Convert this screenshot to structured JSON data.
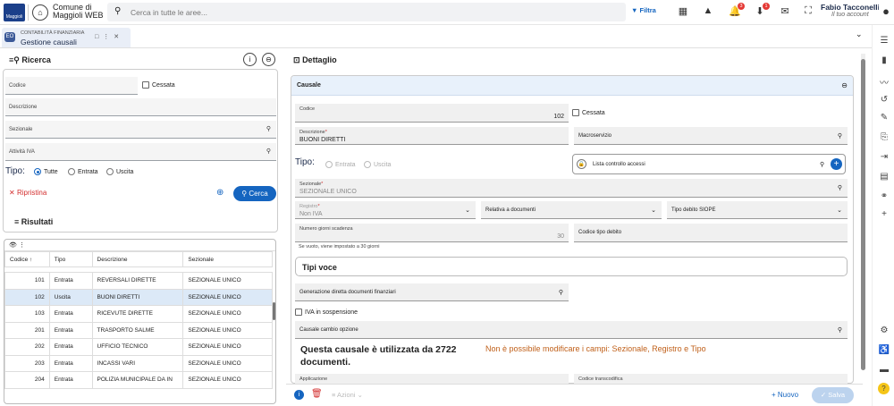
{
  "app": {
    "logo_text": "Maggioli",
    "name_line1": "Comune di",
    "name_line2": "Maggioli WEB"
  },
  "search": {
    "placeholder": "Cerca in tutte le aree..."
  },
  "topbar": {
    "filter_label": "Filtra",
    "badges": {
      "notifications": "3",
      "downloads": "1"
    }
  },
  "user": {
    "name": "Fabio Tacconelli",
    "role": "Il tuo account"
  },
  "tab": {
    "badge": "EO",
    "subtitle": "CONTABILITÀ FINANZIARIA",
    "title": "Gestione causali"
  },
  "ricerca": {
    "title": "Ricerca",
    "fields": {
      "codice": "Codice",
      "descrizione": "Descrizione",
      "sezionale": "Sezionale",
      "attivita_iva": "Attività IVA"
    },
    "cessata_label": "Cessata",
    "tipo_label": "Tipo:",
    "tipo_options": [
      "Tutte",
      "Entrata",
      "Uscita"
    ],
    "ripristina": "Ripristina",
    "cerca": "Cerca"
  },
  "risultati": {
    "title": "Risultati",
    "columns": [
      "Codice ↑",
      "Tipo",
      "Descrizione",
      "Sezionale"
    ],
    "rows": [
      [
        "101",
        "Entrata",
        "REVERSALI DIRETTE",
        "SEZIONALE UNICO"
      ],
      [
        "102",
        "Uscita",
        "BUONI DIRETTI",
        "SEZIONALE UNICO"
      ],
      [
        "103",
        "Entrata",
        "RICEVUTE DIRETTE",
        "SEZIONALE UNICO"
      ],
      [
        "201",
        "Entrata",
        "TRASPORTO SALME",
        "SEZIONALE UNICO"
      ],
      [
        "202",
        "Entrata",
        "UFFICIO TECNICO",
        "SEZIONALE UNICO"
      ],
      [
        "203",
        "Entrata",
        "INCASSI VARI",
        "SEZIONALE UNICO"
      ],
      [
        "204",
        "Entrata",
        "POLIZIA MUNICIPALE DA IN",
        "SEZIONALE UNICO"
      ]
    ]
  },
  "dettaglio": {
    "title": "Dettaglio",
    "card_title": "Causale",
    "codice_label": "Codice",
    "codice_value": "102",
    "cessata_label": "Cessata",
    "descrizione_label": "Descrizione",
    "descrizione_value": "BUONI DIRETTI",
    "macroservizio_label": "Macroservizio",
    "tipo_label": "Tipo:",
    "tipo_options": [
      "Entrata",
      "Uscita"
    ],
    "lista_controllo": "Lista controllo accessi",
    "sezionale_label": "Sezionale",
    "sezionale_value": "SEZIONALE UNICO",
    "registro_label": "Registro",
    "registro_value": "Non IVA",
    "relativa_label": "Relativa a documenti",
    "tipo_debito_label": "Tipo debito SIOPE",
    "numero_giorni_label": "Numero giorni scadenza",
    "numero_giorni_value": "30",
    "numero_giorni_hint": "Se vuoto, viene impostato a 30 giorni",
    "codice_tipo_debito_label": "Codice tipo debito",
    "tipi_voce": "Tipi voce",
    "generazione_label": "Generazione diretta documenti finanziari",
    "iva_sospensione": "IVA in sospensione",
    "causale_cambio": "Causale cambio opzione",
    "info_usage": "Questa causale è utilizzata da 2722 documenti.",
    "info_warning": "Non è possibile modificare i campi: Sezionale, Registro e Tipo",
    "applicazione_label": "Applicazione",
    "codice_transcodifica_label": "Codice transcodifica"
  },
  "footer": {
    "azioni": "Azioni",
    "nuovo": "+ Nuovo",
    "salva": "Salva"
  },
  "colors": {
    "primary": "#1565c0",
    "accent_red": "#d32f2f",
    "card_header": "#e8f1fb",
    "info_warning": "#c0601a"
  }
}
